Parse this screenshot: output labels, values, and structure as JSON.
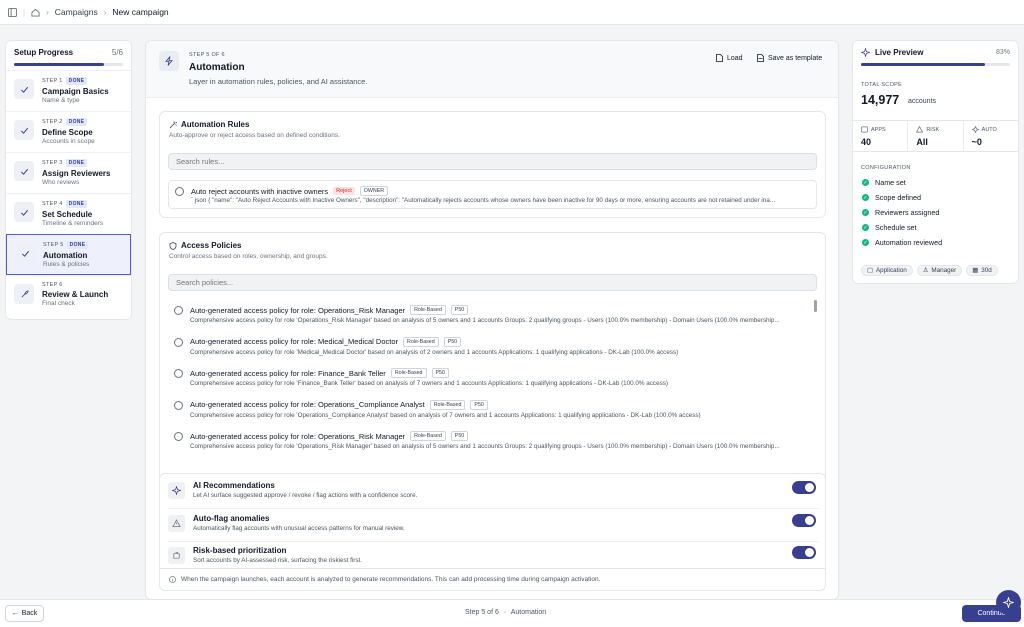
{
  "breadcrumb": {
    "campaigns": "Campaigns",
    "current": "New campaign"
  },
  "progress": {
    "title": "Setup Progress",
    "count": "5/6",
    "fraction": 0.83,
    "steps": [
      {
        "label": "STEP 1",
        "badge": "DONE",
        "title": "Campaign Basics",
        "sub": "Name & type",
        "icon": "check-icon"
      },
      {
        "label": "STEP 2",
        "badge": "DONE",
        "title": "Define Scope",
        "sub": "Accounts in scope",
        "icon": "check-icon"
      },
      {
        "label": "STEP 3",
        "badge": "DONE",
        "title": "Assign Reviewers",
        "sub": "Who reviews",
        "icon": "check-icon"
      },
      {
        "label": "STEP 4",
        "badge": "DONE",
        "title": "Set Schedule",
        "sub": "Timeline & reminders",
        "icon": "check-icon"
      },
      {
        "label": "STEP 5",
        "badge": "DONE",
        "title": "Automation",
        "sub": "Rules & policies",
        "icon": "check-icon"
      },
      {
        "label": "STEP 6",
        "badge": "",
        "title": "Review & Launch",
        "sub": "Final check",
        "icon": "rocket-icon"
      }
    ]
  },
  "header": {
    "step": "STEP 5 OF 6",
    "title": "Automation",
    "desc": "Layer in automation rules, policies, and AI assistance.",
    "load": "Load",
    "save_template": "Save as template"
  },
  "rules": {
    "title": "Automation Rules",
    "desc": "Auto-approve or reject access based on defined conditions.",
    "search_placeholder": "Search rules...",
    "item": {
      "title": "Auto reject accounts with inactive owners",
      "tag1": "Reject",
      "tag2": "OWNER",
      "desc": "` json { \"name\": \"Auto Reject Accounts with Inactive Owners\", \"description\": \"Automatically rejects accounts whose owners have been inactive for 90 days or more, ensuring accounts are not retained under ina..."
    }
  },
  "policies": {
    "title": "Access Policies",
    "desc": "Control access based on roles, ownership, and groups.",
    "search_placeholder": "Search policies...",
    "items": [
      {
        "title": "Auto-generated access policy for role: Operations_Risk Manager",
        "tag": "Role-Based",
        "prio": "P50",
        "desc": "Comprehensive access policy for role 'Operations_Risk Manager' based on analysis of 5 owners and 1 accounts Groups: 2 qualifying groups - Users (100.0% membership) - Domain Users (100.0% membership..."
      },
      {
        "title": "Auto-generated access policy for role: Medical_Medical Doctor",
        "tag": "Role-Based",
        "prio": "P50",
        "desc": "Comprehensive access policy for role 'Medical_Medical Doctor' based on analysis of 2 owners and 1 accounts Applications: 1 qualifying applications - DK-Lab (100.0% access)"
      },
      {
        "title": "Auto-generated access policy for role: Finance_Bank Teller",
        "tag": "Role-Based",
        "prio": "P50",
        "desc": "Comprehensive access policy for role 'Finance_Bank Teller' based on analysis of 7 owners and 1 accounts Applications: 1 qualifying applications - DK-Lab (100.0% access)"
      },
      {
        "title": "Auto-generated access policy for role: Operations_Compliance Analyst",
        "tag": "Role-Based",
        "prio": "P50",
        "desc": "Comprehensive access policy for role 'Operations_Compliance Analyst' based on analysis of 7 owners and 1 accounts Applications: 1 qualifying applications - DK-Lab (100.0% access)"
      },
      {
        "title": "Auto-generated access policy for role: Operations_Risk Manager",
        "tag": "Role-Based",
        "prio": "P50",
        "desc": "Comprehensive access policy for role 'Operations_Risk Manager' based on analysis of 5 owners and 1 accounts Groups: 2 qualifying groups - Users (100.0% membership) - Domain Users (100.0% membership..."
      }
    ]
  },
  "ai": {
    "items": [
      {
        "title": "AI Recommendations",
        "desc": "Let AI surface suggested approve / revoke / flag actions with a confidence score.",
        "on": true
      },
      {
        "title": "Auto-flag anomalies",
        "desc": "Automatically flag accounts with unusual access patterns for manual review.",
        "on": true
      },
      {
        "title": "Risk-based prioritization",
        "desc": "Sort accounts by AI-assessed risk, surfacing the riskiest first.",
        "on": true
      }
    ],
    "footer": "When the campaign launches, each account is analyzed to generate recommendations. This can add processing time during campaign activation."
  },
  "preview": {
    "title": "Live Preview",
    "pct": "83%",
    "fraction": 0.83,
    "scope_label": "TOTAL SCOPE",
    "scope_value": "14,977",
    "scope_unit": "accounts",
    "stats": [
      {
        "label": "APPS",
        "value": "40"
      },
      {
        "label": "RISK",
        "value": "All"
      },
      {
        "label": "AUTO",
        "value": "~0"
      }
    ],
    "config_label": "CONFIGURATION",
    "config": [
      "Name set",
      "Scope defined",
      "Reviewers assigned",
      "Schedule set",
      "Automation reviewed"
    ],
    "chips": [
      "Application",
      "Manager",
      "30d"
    ]
  },
  "footer": {
    "back": "Back",
    "step": "Step 5 of 6",
    "dot": "·",
    "step_name": "Automation",
    "continue": "Continue"
  },
  "colors": {
    "accent": "#374090",
    "success": "#10b981",
    "danger": "#dc2626"
  }
}
